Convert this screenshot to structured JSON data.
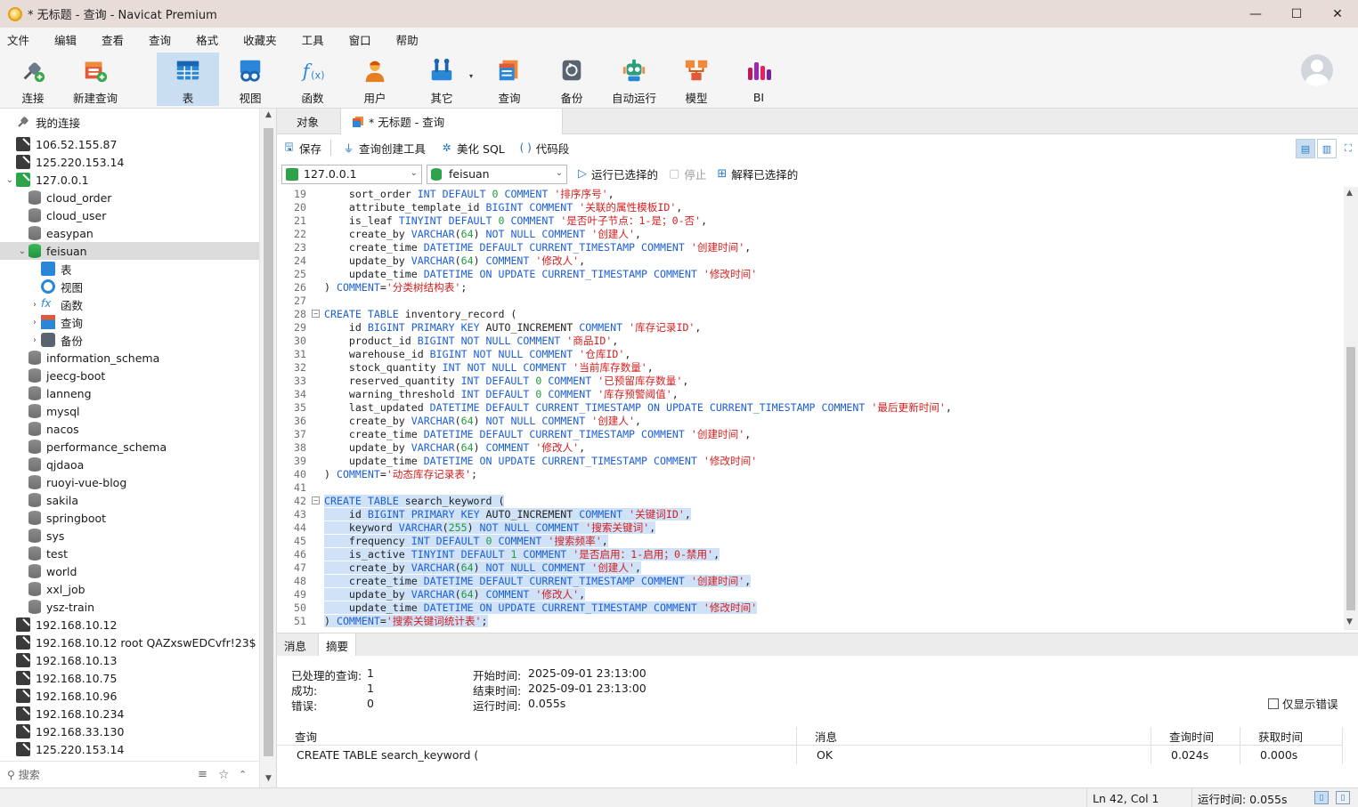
{
  "window": {
    "title": "* 无标题 - 查询 - Navicat Premium",
    "controls": [
      "minimize",
      "maximize",
      "close"
    ]
  },
  "menu": [
    "文件",
    "编辑",
    "查看",
    "查询",
    "格式",
    "收藏夹",
    "工具",
    "窗口",
    "帮助"
  ],
  "toolbar": [
    {
      "label": "连接",
      "icon": "plug-icon"
    },
    {
      "label": "新建查询",
      "icon": "new-query-icon"
    },
    {
      "label": "表",
      "icon": "table-icon",
      "active": true
    },
    {
      "label": "视图",
      "icon": "view-icon"
    },
    {
      "label": "函数",
      "icon": "function-icon"
    },
    {
      "label": "用户",
      "icon": "user-icon"
    },
    {
      "label": "其它",
      "icon": "tools-icon"
    },
    {
      "label": "查询",
      "icon": "query-icon"
    },
    {
      "label": "备份",
      "icon": "backup-icon"
    },
    {
      "label": "自动运行",
      "icon": "robot-icon"
    },
    {
      "label": "模型",
      "icon": "model-icon"
    },
    {
      "label": "BI",
      "icon": "bi-icon"
    }
  ],
  "sidebar": {
    "root": "我的连接",
    "search_placeholder": "搜索",
    "items": [
      {
        "label": "106.52.155.87",
        "type": "conn"
      },
      {
        "label": "125.220.153.14",
        "type": "conn"
      },
      {
        "label": "127.0.0.1",
        "type": "conn-open"
      },
      {
        "label": "cloud_order",
        "type": "db"
      },
      {
        "label": "cloud_user",
        "type": "db"
      },
      {
        "label": "easypan",
        "type": "db"
      },
      {
        "label": "feisuan",
        "type": "db-open"
      },
      {
        "label": "表",
        "type": "obj-table"
      },
      {
        "label": "视图",
        "type": "obj-view"
      },
      {
        "label": "函数",
        "type": "obj-func"
      },
      {
        "label": "查询",
        "type": "obj-query"
      },
      {
        "label": "备份",
        "type": "obj-backup"
      },
      {
        "label": "information_schema",
        "type": "db"
      },
      {
        "label": "jeecg-boot",
        "type": "db"
      },
      {
        "label": "lanneng",
        "type": "db"
      },
      {
        "label": "mysql",
        "type": "db"
      },
      {
        "label": "nacos",
        "type": "db"
      },
      {
        "label": "performance_schema",
        "type": "db"
      },
      {
        "label": "qjdaoa",
        "type": "db"
      },
      {
        "label": "ruoyi-vue-blog",
        "type": "db"
      },
      {
        "label": "sakila",
        "type": "db"
      },
      {
        "label": "springboot",
        "type": "db"
      },
      {
        "label": "sys",
        "type": "db"
      },
      {
        "label": "test",
        "type": "db"
      },
      {
        "label": "world",
        "type": "db"
      },
      {
        "label": "xxl_job",
        "type": "db"
      },
      {
        "label": "ysz-train",
        "type": "db"
      },
      {
        "label": "192.168.10.12",
        "type": "conn"
      },
      {
        "label": "192.168.10.12 root QAZxswEDCvfr!23$",
        "type": "conn"
      },
      {
        "label": "192.168.10.13",
        "type": "conn"
      },
      {
        "label": "192.168.10.75",
        "type": "conn"
      },
      {
        "label": "192.168.10.96",
        "type": "conn"
      },
      {
        "label": "192.168.10.234",
        "type": "conn"
      },
      {
        "label": "192.168.33.130",
        "type": "conn"
      },
      {
        "label": "125.220.153.14",
        "type": "conn-pg"
      }
    ]
  },
  "tabs": {
    "objects": "对象",
    "query": "* 无标题 - 查询"
  },
  "query_toolbar": {
    "save": "保存",
    "builder": "查询创建工具",
    "beautify": "美化 SQL",
    "snippet": "代码段"
  },
  "conn_bar": {
    "connection": "127.0.0.1",
    "database": "feisuan",
    "run_selected": "运行已选择的",
    "stop": "停止",
    "explain": "解释已选择的"
  },
  "editor": {
    "lines": [
      {
        "n": "19",
        "code": "    sort_order INT DEFAULT 0 COMMENT '排序序号',"
      },
      {
        "n": "20",
        "code": "    attribute_template_id BIGINT COMMENT '关联的属性模板ID',"
      },
      {
        "n": "21",
        "code": "    is_leaf TINYINT DEFAULT 0 COMMENT '是否叶子节点：1-是；0-否',"
      },
      {
        "n": "22",
        "code": "    create_by VARCHAR(64) NOT NULL COMMENT '创建人',"
      },
      {
        "n": "23",
        "code": "    create_time DATETIME DEFAULT CURRENT_TIMESTAMP COMMENT '创建时间',"
      },
      {
        "n": "24",
        "code": "    update_by VARCHAR(64) COMMENT '修改人',"
      },
      {
        "n": "25",
        "code": "    update_time DATETIME ON UPDATE CURRENT_TIMESTAMP COMMENT '修改时间'"
      },
      {
        "n": "26",
        "code": ") COMMENT='分类树结构表';"
      },
      {
        "n": "27",
        "code": ""
      },
      {
        "n": "28",
        "code": "CREATE TABLE inventory_record (",
        "fold": true
      },
      {
        "n": "29",
        "code": "    id BIGINT PRIMARY KEY AUTO_INCREMENT COMMENT '库存记录ID',"
      },
      {
        "n": "30",
        "code": "    product_id BIGINT NOT NULL COMMENT '商品ID',"
      },
      {
        "n": "31",
        "code": "    warehouse_id BIGINT NOT NULL COMMENT '仓库ID',"
      },
      {
        "n": "32",
        "code": "    stock_quantity INT NOT NULL COMMENT '当前库存数量',"
      },
      {
        "n": "33",
        "code": "    reserved_quantity INT DEFAULT 0 COMMENT '已预留库存数量',"
      },
      {
        "n": "34",
        "code": "    warning_threshold INT DEFAULT 0 COMMENT '库存预警阈值',"
      },
      {
        "n": "35",
        "code": "    last_updated DATETIME DEFAULT CURRENT_TIMESTAMP ON UPDATE CURRENT_TIMESTAMP COMMENT '最后更新时间',"
      },
      {
        "n": "36",
        "code": "    create_by VARCHAR(64) NOT NULL COMMENT '创建人',"
      },
      {
        "n": "37",
        "code": "    create_time DATETIME DEFAULT CURRENT_TIMESTAMP COMMENT '创建时间',"
      },
      {
        "n": "38",
        "code": "    update_by VARCHAR(64) COMMENT '修改人',"
      },
      {
        "n": "39",
        "code": "    update_time DATETIME ON UPDATE CURRENT_TIMESTAMP COMMENT '修改时间'"
      },
      {
        "n": "40",
        "code": ") COMMENT='动态库存记录表';"
      },
      {
        "n": "41",
        "code": ""
      },
      {
        "n": "42",
        "code": "CREATE TABLE search_keyword (",
        "fold": true,
        "sel": true
      },
      {
        "n": "43",
        "code": "    id BIGINT PRIMARY KEY AUTO_INCREMENT COMMENT '关键词ID',",
        "sel": true
      },
      {
        "n": "44",
        "code": "    keyword VARCHAR(255) NOT NULL COMMENT '搜索关键词',",
        "sel": true
      },
      {
        "n": "45",
        "code": "    frequency INT DEFAULT 0 COMMENT '搜索频率',",
        "sel": true
      },
      {
        "n": "46",
        "code": "    is_active TINYINT DEFAULT 1 COMMENT '是否启用：1-启用；0-禁用',",
        "sel": true
      },
      {
        "n": "47",
        "code": "    create_by VARCHAR(64) NOT NULL COMMENT '创建人',",
        "sel": true
      },
      {
        "n": "48",
        "code": "    create_time DATETIME DEFAULT CURRENT_TIMESTAMP COMMENT '创建时间',",
        "sel": true
      },
      {
        "n": "49",
        "code": "    update_by VARCHAR(64) COMMENT '修改人',",
        "sel": true
      },
      {
        "n": "50",
        "code": "    update_time DATETIME ON UPDATE CURRENT_TIMESTAMP COMMENT '修改时间'",
        "sel": true
      },
      {
        "n": "51",
        "code": ") COMMENT='搜索关键词统计表';",
        "sel": true
      }
    ]
  },
  "result": {
    "tabs": {
      "message": "消息",
      "summary": "摘要"
    },
    "processed_label": "已处理的查询:",
    "processed_value": "1",
    "success_label": "成功:",
    "success_value": "1",
    "error_label": "错误:",
    "error_value": "0",
    "start_label": "开始时间:",
    "start_value": "2025-09-01 23:13:00",
    "end_label": "结束时间:",
    "end_value": "2025-09-01 23:13:00",
    "runtime_label": "运行时间:",
    "runtime_value": "0.055s",
    "only_errors": "仅显示错误",
    "columns": [
      "查询",
      "消息",
      "查询时间",
      "获取时间"
    ],
    "rows": [
      {
        "query": "CREATE TABLE search_keyword (",
        "message": "OK",
        "query_time": "0.024s",
        "fetch_time": "0.000s"
      }
    ]
  },
  "status": {
    "position": "Ln 42, Col 1",
    "runtime": "运行时间: 0.055s"
  },
  "colors": {
    "keyword": "#1c5fd6",
    "string": "#d41e1e",
    "number": "#1f9b3a",
    "selection": "#cfe2f8",
    "active_tool": "#c9dff1"
  }
}
